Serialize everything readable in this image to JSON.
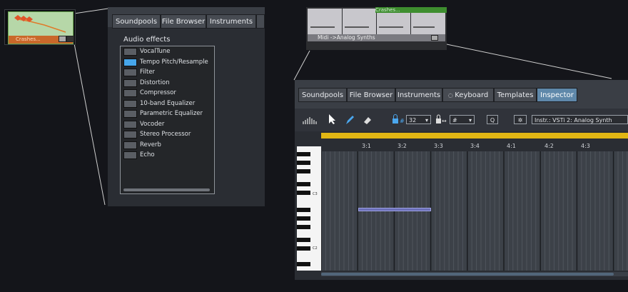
{
  "clip_left": {
    "label": "Crashes..."
  },
  "panel_effects": {
    "tabs": [
      "Soundpools",
      "File Browser",
      "Instruments"
    ],
    "section_title": "Audio effects",
    "effects": [
      {
        "name": "VocalTune",
        "active": false
      },
      {
        "name": "Tempo Pitch/Resample",
        "active": true
      },
      {
        "name": "Filter",
        "active": false
      },
      {
        "name": "Distortion",
        "active": false
      },
      {
        "name": "Compressor",
        "active": false
      },
      {
        "name": "10-band Equalizer",
        "active": false
      },
      {
        "name": "Parametric Equalizer",
        "active": false
      },
      {
        "name": "Vocoder",
        "active": false
      },
      {
        "name": "Stereo Processor",
        "active": false
      },
      {
        "name": "Reverb",
        "active": false
      },
      {
        "name": "Echo",
        "active": false
      }
    ]
  },
  "clip_right": {
    "crashes_label": "Crashes...",
    "midi_label": "Midi ->Analog Synths"
  },
  "panel_editor": {
    "tabs": [
      "Soundpools",
      "File Browser",
      "Instruments",
      "Keyboard",
      "Templates",
      "Inspector"
    ],
    "active_tab": "Inspector",
    "quantize": "32",
    "grid": "#",
    "q_label": "Q",
    "instrument": "Instr.: VSTi 2: Analog Synth",
    "bar_labels": [
      "3:1",
      "3:2",
      "3:3",
      "3:4",
      "4:1",
      "4:2",
      "4:3"
    ],
    "piano_labels": [
      "C3",
      "C2"
    ]
  },
  "colors": {
    "accent": "#46a6ea",
    "ruler": "#e1b614",
    "clip_orange": "#c9682a",
    "clip_green": "#b6d7a8"
  }
}
